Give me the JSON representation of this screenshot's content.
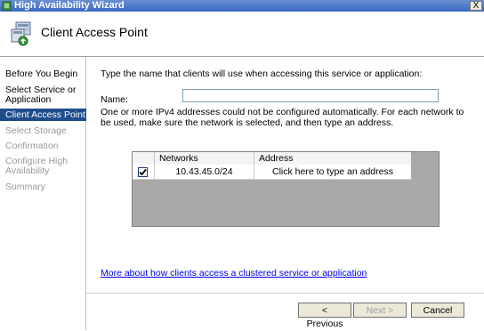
{
  "window": {
    "title": "High Availability Wizard",
    "close_glyph": "X"
  },
  "header": {
    "title": "Client Access Point",
    "icon": "cluster-wizard-icon"
  },
  "nav": {
    "items": [
      {
        "label": "Before You Begin",
        "state": "normal"
      },
      {
        "label": "Select Service or Application",
        "state": "normal"
      },
      {
        "label": "Client Access Point",
        "state": "selected"
      },
      {
        "label": "Select Storage",
        "state": "disabled"
      },
      {
        "label": "Confirmation",
        "state": "disabled"
      },
      {
        "label": "Configure High Availability",
        "state": "disabled"
      },
      {
        "label": "Summary",
        "state": "disabled"
      }
    ]
  },
  "main": {
    "instruction": "Type the name that clients will use when accessing this service or application:",
    "name_label": "Name:",
    "name_value": "",
    "message": "One or more IPv4 addresses could not be configured automatically.  For each network to be used, make sure the network is selected, and then type an address.",
    "grid": {
      "columns": [
        "Networks",
        "Address"
      ],
      "rows": [
        {
          "checked": true,
          "network": "10.43.45.0/24",
          "address": "Click here to type an address"
        }
      ]
    },
    "help_link": "More about how clients access a clustered service or application"
  },
  "buttons": {
    "previous": "< Previous",
    "next": "Next >",
    "cancel": "Cancel"
  },
  "colors": {
    "nav_selected": "#1f4d8c",
    "link": "#0000ee",
    "grid_background": "#a9a9a9"
  }
}
